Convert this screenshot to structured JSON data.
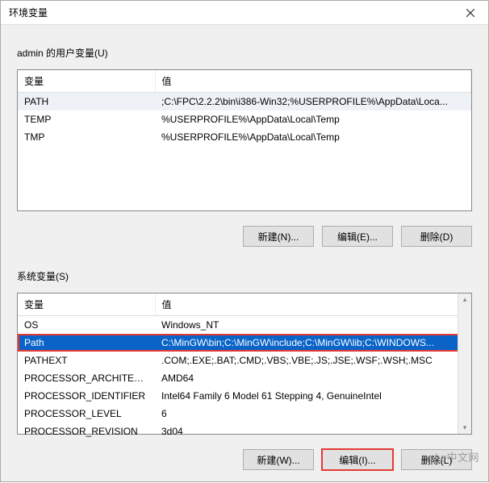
{
  "dialog": {
    "title": "环境变量"
  },
  "user_section": {
    "label": "admin 的用户变量(U)",
    "columns": {
      "variable": "变量",
      "value": "值"
    },
    "rows": [
      {
        "variable": "PATH",
        "value": ";C:\\FPC\\2.2.2\\bin\\i386-Win32;%USERPROFILE%\\AppData\\Loca..."
      },
      {
        "variable": "TEMP",
        "value": "%USERPROFILE%\\AppData\\Local\\Temp"
      },
      {
        "variable": "TMP",
        "value": "%USERPROFILE%\\AppData\\Local\\Temp"
      }
    ],
    "buttons": {
      "new": "新建(N)...",
      "edit": "编辑(E)...",
      "delete": "删除(D)"
    }
  },
  "system_section": {
    "label": "系统变量(S)",
    "columns": {
      "variable": "变量",
      "value": "值"
    },
    "rows": [
      {
        "variable": "OS",
        "value": "Windows_NT"
      },
      {
        "variable": "Path",
        "value": "C:\\MinGW\\bin;C:\\MinGW\\include;C:\\MinGW\\lib;C:\\WINDOWS..."
      },
      {
        "variable": "PATHEXT",
        "value": ".COM;.EXE;.BAT;.CMD;.VBS;.VBE;.JS;.JSE;.WSF;.WSH;.MSC"
      },
      {
        "variable": "PROCESSOR_ARCHITECT...",
        "value": "AMD64"
      },
      {
        "variable": "PROCESSOR_IDENTIFIER",
        "value": "Intel64 Family 6 Model 61 Stepping 4, GenuineIntel"
      },
      {
        "variable": "PROCESSOR_LEVEL",
        "value": "6"
      },
      {
        "variable": "PROCESSOR_REVISION",
        "value": "3d04"
      }
    ],
    "selected_index": 1,
    "buttons": {
      "new": "新建(W)...",
      "edit": "编辑(I)...",
      "delete": "删除(L)"
    }
  },
  "watermark": {
    "text_en": "php",
    "text_cn": "中文网"
  }
}
